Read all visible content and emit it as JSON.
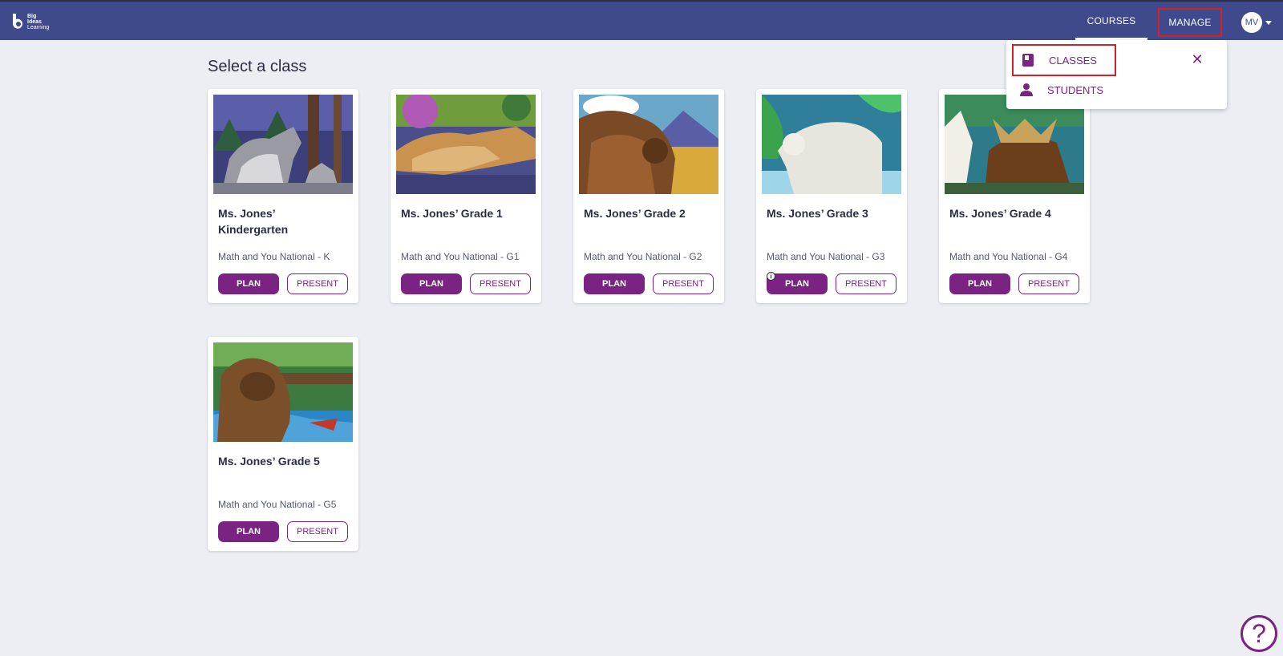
{
  "brand": {
    "line1": "Big",
    "line2": "Ideas",
    "line3": "Learning"
  },
  "nav": {
    "courses": "COURSES",
    "manage": "MANAGE",
    "avatar_initials": "MV"
  },
  "page_title": "Select a class",
  "dropdown": {
    "items": [
      {
        "label": "CLASSES",
        "icon": "book-icon"
      },
      {
        "label": "STUDENTS",
        "icon": "person-icon"
      }
    ],
    "close_glyph": "✕"
  },
  "cards": [
    {
      "title": "Ms. Jones’ Kindergarten",
      "course": "Math and You National - K",
      "plan": "PLAN",
      "present": "PRESENT",
      "image": "wolves-image"
    },
    {
      "title": "Ms. Jones’ Grade 1",
      "course": "Math and You National - G1",
      "plan": "PLAN",
      "present": "PRESENT",
      "image": "cougar-image"
    },
    {
      "title": "Ms. Jones’ Grade 2",
      "course": "Math and You National - G2",
      "plan": "PLAN",
      "present": "PRESENT",
      "image": "bison-image"
    },
    {
      "title": "Ms. Jones’ Grade 3",
      "course": "Math and You National - G3",
      "plan": "PLAN",
      "present": "PRESENT",
      "image": "polar-bear-image"
    },
    {
      "title": "Ms. Jones’ Grade 4",
      "course": "Math and You National - G4",
      "plan": "PLAN",
      "present": "PRESENT",
      "image": "moose-image"
    },
    {
      "title": "Ms. Jones’ Grade 5",
      "course": "Math and You National - G5",
      "plan": "PLAN",
      "present": "PRESENT",
      "image": "grizzly-image"
    }
  ],
  "help_glyph": "?",
  "info_glyph": "i",
  "colors": {
    "topbar": "#3f4a8c",
    "accent": "#7b2383",
    "highlight": "#d0202a",
    "page_bg": "#eceef4"
  }
}
